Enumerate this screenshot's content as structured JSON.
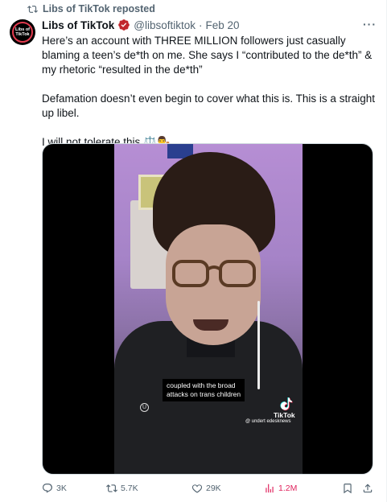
{
  "repost_banner": {
    "label": "Libs of TikTok reposted"
  },
  "author": {
    "avatar_text_line1": "Libs of",
    "avatar_text_line2": "TikTok",
    "name": "Libs of TikTok",
    "handle": "@libsoftiktok",
    "separator": "·",
    "date": "Feb 20",
    "verified": true
  },
  "more_menu": {
    "label": "···"
  },
  "tweet": {
    "paragraph1": "Here’s an account with THREE MILLION followers just casually blaming a teen’s de*th on me. She says I “contributed to the de*th” & my rhetoric “resulted in the de*th”",
    "paragraph2": "Defamation doesn’t even begin to cover what this is. This is a straight up libel.",
    "paragraph3": "I will not tolerate this ⚖️👨‍⚖️"
  },
  "video": {
    "caption_line1": "coupled with the broad",
    "caption_line2": "attacks on trans children",
    "watermark_brand": "TikTok",
    "watermark_handle": "@ undert  edesknews",
    "badge": "U"
  },
  "actions": {
    "replies": "3K",
    "reposts": "5.7K",
    "likes": "29K",
    "views": "1.2M"
  },
  "colors": {
    "secondary_text": "#536471",
    "primary_text": "#0f1419",
    "views_accent": "#e0245e",
    "verified_badge": "#c1272d"
  }
}
